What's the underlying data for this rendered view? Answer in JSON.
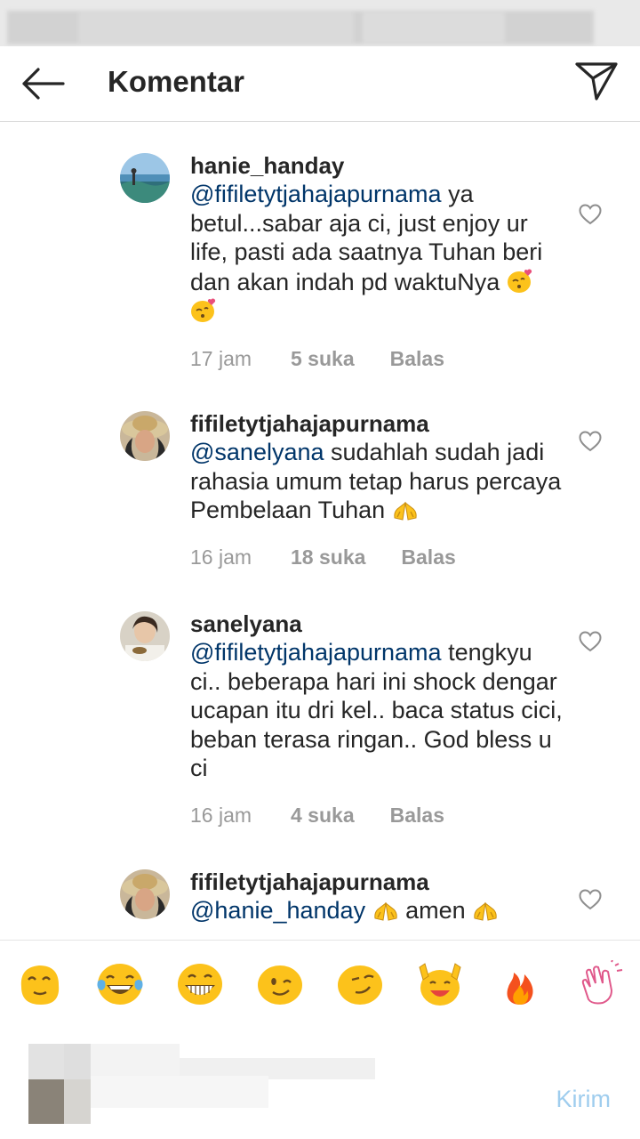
{
  "header": {
    "title": "Komentar",
    "back_icon": "arrow-left-icon",
    "direct_icon": "paper-plane-icon"
  },
  "comments": [
    {
      "username": "hanie_handay",
      "mention": "@fifiletytjahajapurnama",
      "text": " ya betul...sabar aja ci, just enjoy ur life, pasti ada saatnya Tuhan beri dan akan indah pd waktuNya",
      "emojis": [
        "kissing-face-with-heart-emoji",
        "kissing-face-with-heart-emoji"
      ],
      "time": "17 jam",
      "likes": "5 suka",
      "reply": "Balas"
    },
    {
      "username": "fifiletytjahajapurnama",
      "mention": "@sanelyana",
      "text": " sudahlah sudah jadi rahasia umum tetap harus percaya Pembelaan Tuhan",
      "emojis": [
        "folded-hands-emoji"
      ],
      "time": "16 jam",
      "likes": "18 suka",
      "reply": "Balas"
    },
    {
      "username": "sanelyana",
      "mention": "@fifiletytjahajapurnama",
      "text": " tengkyu ci.. beberapa hari ini shock dengar ucapan itu dri kel.. baca status cici, beban terasa ringan.. God bless u ci",
      "emojis": [],
      "time": "16 jam",
      "likes": "4 suka",
      "reply": "Balas"
    },
    {
      "username": "fifiletytjahajapurnama",
      "mention": "@hanie_handay",
      "text": "amen",
      "emojis": [
        "folded-hands-emoji",
        "folded-hands-emoji"
      ],
      "time": "",
      "likes": "",
      "reply": ""
    }
  ],
  "emoji_bar": [
    "relieved-face-emoji",
    "tears-of-joy-emoji",
    "grinning-face-emoji",
    "winking-face-emoji",
    "smirking-face-emoji",
    "raised-hands-emoji",
    "fire-emoji",
    "clapping-hands-emoji"
  ],
  "composer": {
    "placeholder": "",
    "post_label": "Kirim"
  },
  "colors": {
    "mention": "#003569",
    "meta": "#999999",
    "post_disabled": "#9fcdee",
    "emoji_yellow": "#fcc21b"
  }
}
